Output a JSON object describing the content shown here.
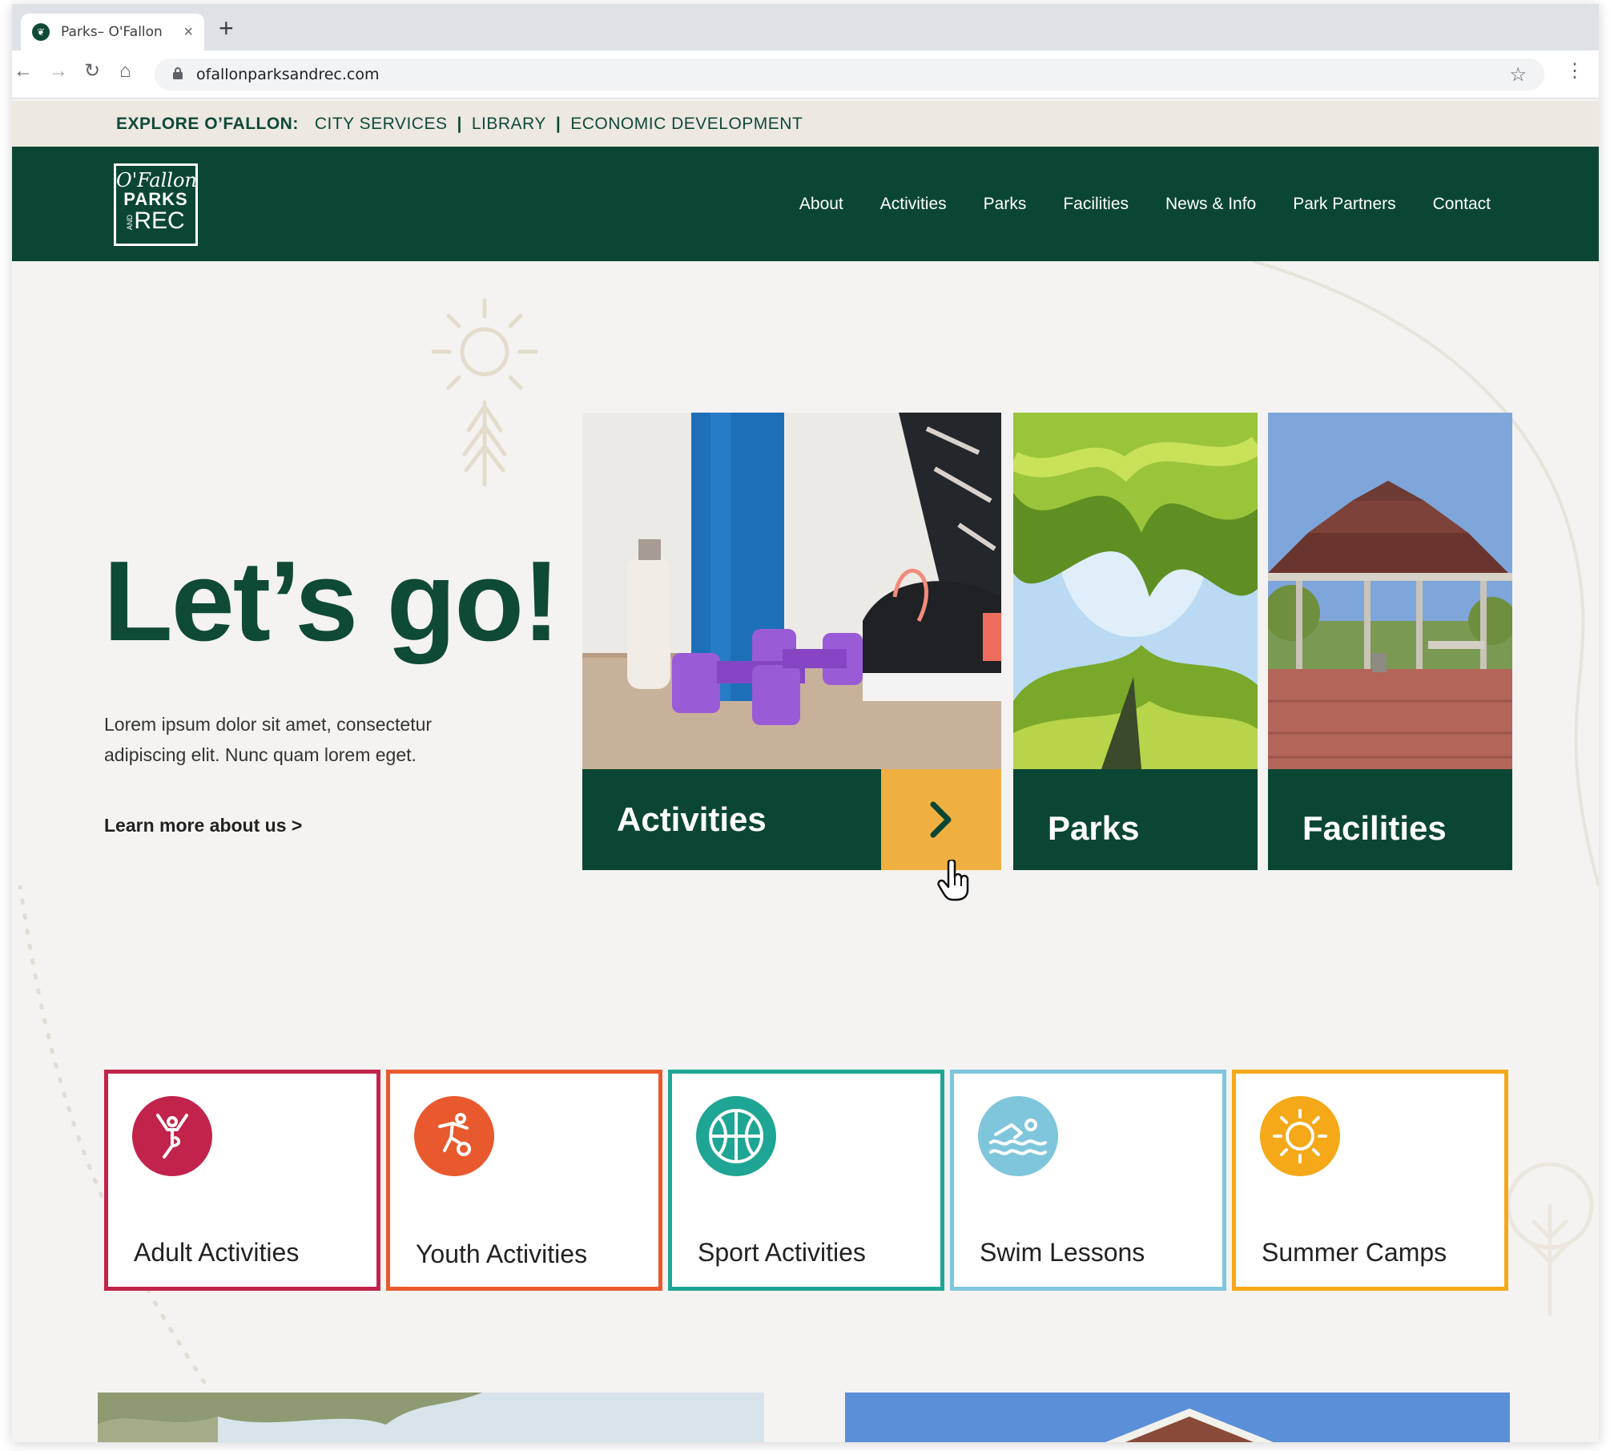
{
  "browser": {
    "tab_title": "Parks– O'Fallon",
    "tab_close": "×",
    "new_tab": "+",
    "url": "ofallonparksandrec.com",
    "back": "←",
    "forward": "→",
    "reload": "↻",
    "home": "⌂",
    "bookmark": "☆",
    "menu": "⋮"
  },
  "explore": {
    "label": "EXPLORE O’FALLON:",
    "links": [
      "CITY SERVICES",
      "LIBRARY",
      "ECONOMIC DEVELOPMENT"
    ],
    "separator": "|"
  },
  "header": {
    "logo": {
      "script": "O'Fallon",
      "parks": "PARKS",
      "and": "AND",
      "rec": "REC"
    },
    "nav": [
      "About",
      "Activities",
      "Parks",
      "Facilities",
      "News & Info",
      "Park Partners",
      "Contact"
    ]
  },
  "hero": {
    "title": "Let’s go!",
    "text": "Lorem ipsum dolor sit amet, consectetur adipiscing elit. Nunc quam lorem eget.",
    "link": "Learn more about us >"
  },
  "cards": [
    {
      "label": "Activities",
      "image": "fitness-photo",
      "arrow": "chevron-right-icon",
      "hover": true
    },
    {
      "label": "Parks",
      "image": "tree-canopy-photo"
    },
    {
      "label": "Facilities",
      "image": "pavilion-photo"
    }
  ],
  "activities": [
    {
      "label": "Adult Activities",
      "color": "#c2234a",
      "icon": "yoga-icon"
    },
    {
      "label": "Youth Activities",
      "color": "#e9592e",
      "icon": "soccer-icon"
    },
    {
      "label": "Sport Activities",
      "color": "#1fa594",
      "icon": "basketball-icon"
    },
    {
      "label": "Swim Lessons",
      "color": "#7fc6dc",
      "icon": "swimmer-icon"
    },
    {
      "label": "Summer Camps",
      "color": "#f5a818",
      "icon": "sun-icon"
    }
  ],
  "colors": {
    "brand_green": "#0b4634",
    "accent_yellow": "#efb041",
    "background": "#f4f3f1",
    "explore_bar": "#ede8e2"
  }
}
